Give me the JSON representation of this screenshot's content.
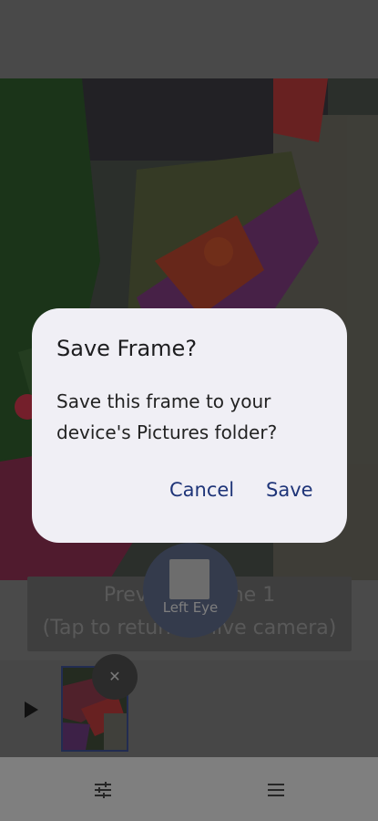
{
  "dialog": {
    "title": "Save Frame?",
    "message_line1": "Save this frame to your",
    "message_line2": "device's Pictures folder?",
    "cancel_label": "Cancel",
    "save_label": "Save"
  },
  "preview_banner": {
    "line1": "Preview: Frame 1",
    "line2": "(Tap to return to live camera)"
  },
  "eye_toggle": {
    "label": "Left Eye"
  },
  "thumbnail": {
    "close_glyph": "✕"
  },
  "icons": {
    "play": "play-icon",
    "close": "close-icon",
    "settings": "sliders-icon",
    "menu": "menu-icon"
  },
  "colors": {
    "accent": "#1e3478",
    "dialog_bg": "#f0eff5",
    "eye_button": "#5b6684"
  }
}
